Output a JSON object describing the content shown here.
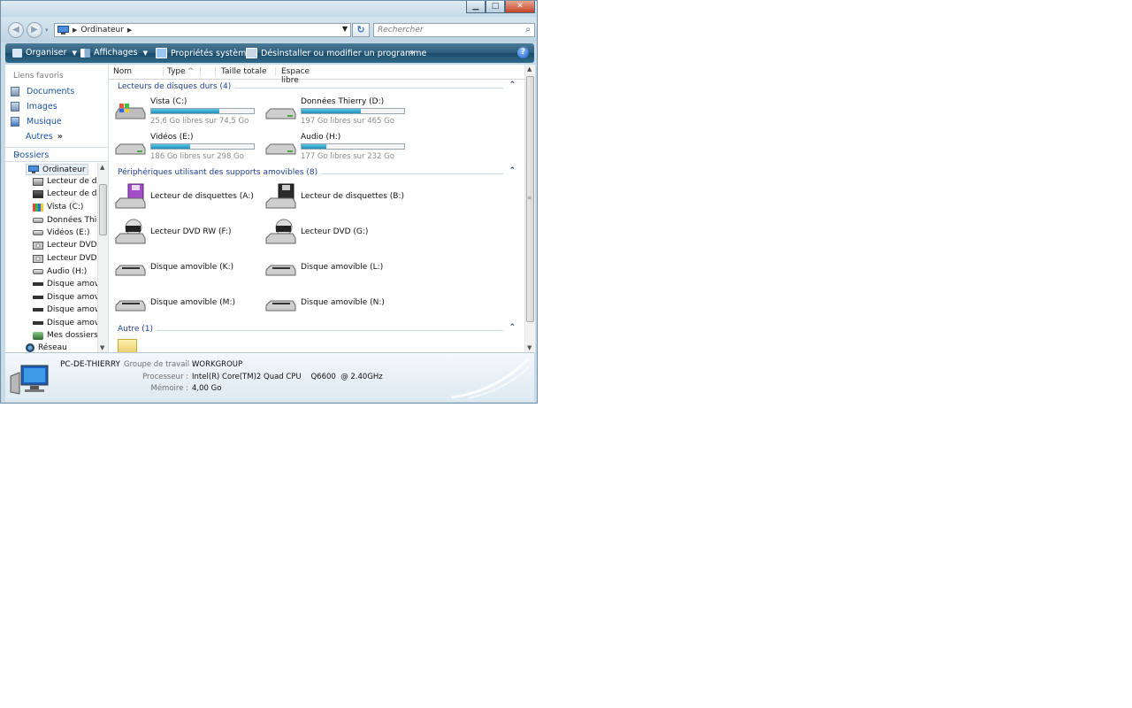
{
  "window": {
    "title_buttons": [
      "minimize-icon",
      "maximize-icon",
      "close-icon"
    ]
  },
  "address": {
    "crumb": "Ordinateur",
    "search_placeholder": "Rechercher"
  },
  "toolbar": {
    "organize": "Organiser",
    "views": "Affichages",
    "system_props": "Propriétés système",
    "uninstall": "Désinstaller ou modifier un programme",
    "more": "»",
    "help": "?"
  },
  "sidebar": {
    "favorites_title": "Liens favoris",
    "favorites": [
      "Documents",
      "Images",
      "Musique"
    ],
    "more_label": "Autres",
    "more_chevron": "»",
    "folders_title": "Dossiers",
    "tree": [
      {
        "label": "Ordinateur",
        "icon": "computer-icon"
      },
      {
        "label": "Lecteur de dis",
        "icon": "floppy-icon"
      },
      {
        "label": "Lecteur de dis",
        "icon": "floppy-icon"
      },
      {
        "label": "Vista (C:)",
        "icon": "system-drive-icon"
      },
      {
        "label": "Données Thie",
        "icon": "hard-drive-icon"
      },
      {
        "label": "Vidéos (E:)",
        "icon": "hard-drive-icon"
      },
      {
        "label": "Lecteur DVD I",
        "icon": "dvd-icon"
      },
      {
        "label": "Lecteur DVD (",
        "icon": "dvd-icon"
      },
      {
        "label": "Audio (H:)",
        "icon": "hard-drive-icon"
      },
      {
        "label": "Disque amov",
        "icon": "removable-drive-icon"
      },
      {
        "label": "Disque amov",
        "icon": "removable-drive-icon"
      },
      {
        "label": "Disque amov",
        "icon": "removable-drive-icon"
      },
      {
        "label": "Disque amov",
        "icon": "removable-drive-icon"
      },
      {
        "label": "Mes dossiers",
        "icon": "shared-folders-icon"
      },
      {
        "label": "Réseau",
        "icon": "network-icon"
      }
    ]
  },
  "columns": [
    "Nom",
    "Type",
    "Taille totale",
    "Espace libre"
  ],
  "groups": [
    {
      "title": "Lecteurs de disques durs (4)"
    },
    {
      "title": "Périphériques utilisant des supports amovibles (8)"
    },
    {
      "title": "Autre (1)"
    }
  ],
  "drives": [
    {
      "name": "Vista (C:)",
      "free": "25,6 Go libres sur 74,5 Go",
      "used_fraction": 0.66,
      "icon": "system-drive-icon"
    },
    {
      "name": "Données Thierry (D:)",
      "free": "197 Go libres sur 465 Go",
      "used_fraction": 0.58,
      "icon": "hard-drive-icon"
    },
    {
      "name": "Vidéos (E:)",
      "free": "186 Go libres sur 298 Go",
      "used_fraction": 0.38,
      "icon": "hard-drive-icon"
    },
    {
      "name": "Audio (H:)",
      "free": "177 Go libres sur 232 Go",
      "used_fraction": 0.24,
      "icon": "hard-drive-icon"
    }
  ],
  "devices": [
    {
      "name": "Lecteur de disquettes (A:)",
      "icon": "floppy-icon"
    },
    {
      "name": "Lecteur de disquettes (B:)",
      "icon": "floppy-icon"
    },
    {
      "name": "Lecteur DVD RW (F:)",
      "icon": "dvd-icon"
    },
    {
      "name": "Lecteur DVD (G:)",
      "icon": "dvd-icon"
    },
    {
      "name": "Disque amovible (K:)",
      "icon": "removable-drive-icon"
    },
    {
      "name": "Disque amovible (L:)",
      "icon": "removable-drive-icon"
    },
    {
      "name": "Disque amovible (M:)",
      "icon": "removable-drive-icon"
    },
    {
      "name": "Disque amovible (N:)",
      "icon": "removable-drive-icon"
    }
  ],
  "details": {
    "computer_name": "PC-DE-THIERRY",
    "workgroup_label": "Groupe de travail :",
    "workgroup": "WORKGROUP",
    "cpu_label": "Processeur :",
    "cpu": "Intel(R) Core(TM)2 Quad CPU    Q6600  @ 2.40GHz",
    "mem_label": "Mémoire :",
    "mem": "4,00 Go"
  },
  "colors": {
    "toolbar": "#2b5d7c",
    "link": "#1a52a3",
    "group_title": "#1e3d8f",
    "bar_fill": "#1e8fb9"
  }
}
